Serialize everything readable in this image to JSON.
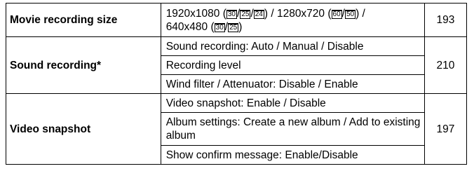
{
  "header_fragment": "",
  "rows": [
    {
      "item": "Movie recording size",
      "desc": [
        "1920x1080 (",
        "30",
        "/",
        "25",
        "/",
        "24",
        ") / 1280x720 (",
        "60",
        "/",
        "50",
        ") /",
        "640x480 (",
        "30",
        "/",
        "25",
        ")"
      ],
      "page": "193"
    },
    {
      "item": "Sound recording*",
      "page": "210",
      "subs": [
        "Sound recording: Auto / Manual / Disable",
        "Recording level",
        "Wind filter / Attenuator: Disable / Enable"
      ]
    },
    {
      "item": "Video snapshot",
      "page": "197",
      "subs": [
        "Video snapshot: Enable / Disable",
        "Album settings: Create a new album / Add to existing album",
        "Show confirm message: Enable/Disable"
      ]
    }
  ],
  "frame_rate_icon_names": [
    "30p-icon",
    "25p-icon",
    "24p-icon",
    "60p-icon",
    "50p-icon"
  ]
}
